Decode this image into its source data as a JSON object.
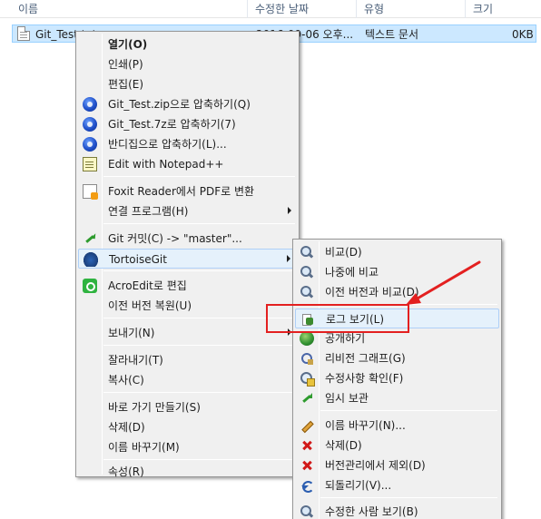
{
  "explorer": {
    "columns": [
      "이름",
      "수정한 날짜",
      "유형",
      "크기"
    ],
    "file": {
      "name": "Git_Test.txt",
      "modified": "2016-09-06 오후...",
      "type": "텍스트 문서",
      "size": "0KB"
    }
  },
  "context_menu": {
    "items": [
      {
        "label": "열기(O)"
      },
      {
        "label": "인쇄(P)"
      },
      {
        "label": "편집(E)"
      },
      {
        "label": "Git_Test.zip으로 압축하기(Q)",
        "icon": "zip-icon"
      },
      {
        "label": "Git_Test.7z로 압축하기(7)",
        "icon": "zip-icon"
      },
      {
        "label": "반디집으로 압축하기(L)...",
        "icon": "zip-icon"
      },
      {
        "label": "Edit with Notepad++",
        "icon": "notepad-icon"
      },
      {
        "label": "Foxit Reader에서 PDF로 변환",
        "icon": "foxit-icon"
      },
      {
        "label": "연결 프로그램(H)"
      },
      {
        "label": "Git 커밋(C) -> \"master\"...",
        "icon": "git-commit-icon"
      },
      {
        "label": "TortoiseGit",
        "icon": "tortoisegit-icon"
      },
      {
        "label": "AcroEdit로 편집",
        "icon": "acroedit-icon"
      },
      {
        "label": "이전 버전 복원(U)"
      },
      {
        "label": "보내기(N)"
      },
      {
        "label": "잘라내기(T)"
      },
      {
        "label": "복사(C)"
      },
      {
        "label": "바로 가기 만들기(S)"
      },
      {
        "label": "삭제(D)"
      },
      {
        "label": "이름 바꾸기(M)"
      },
      {
        "label": "속성(R)"
      }
    ]
  },
  "tortoisegit_menu": {
    "items": [
      {
        "label": "비교(D)",
        "icon": "magnifier-icon"
      },
      {
        "label": "나중에 비교",
        "icon": "magnifier-icon"
      },
      {
        "label": "이전 버전과 비교(D)",
        "icon": "magnifier-icon"
      },
      {
        "label": "로그 보기(L)",
        "icon": "log-icon"
      },
      {
        "label": "공개하기",
        "icon": "globe-icon"
      },
      {
        "label": "리비전 그래프(G)",
        "icon": "revision-graph-icon"
      },
      {
        "label": "수정사항 확인(F)",
        "icon": "check-modifications-icon"
      },
      {
        "label": "임시 보관",
        "icon": "stash-icon"
      },
      {
        "label": "이름 바꾸기(N)...",
        "icon": "pencil-icon"
      },
      {
        "label": "삭제(D)",
        "icon": "delete-x-icon"
      },
      {
        "label": "버전관리에서 제외(D)",
        "icon": "delete-x-icon"
      },
      {
        "label": "되돌리기(V)...",
        "icon": "revert-icon"
      },
      {
        "label": "수정한 사람 보기(B)",
        "icon": "magnifier-icon"
      }
    ]
  },
  "annotation": {
    "color": "#e32020"
  }
}
